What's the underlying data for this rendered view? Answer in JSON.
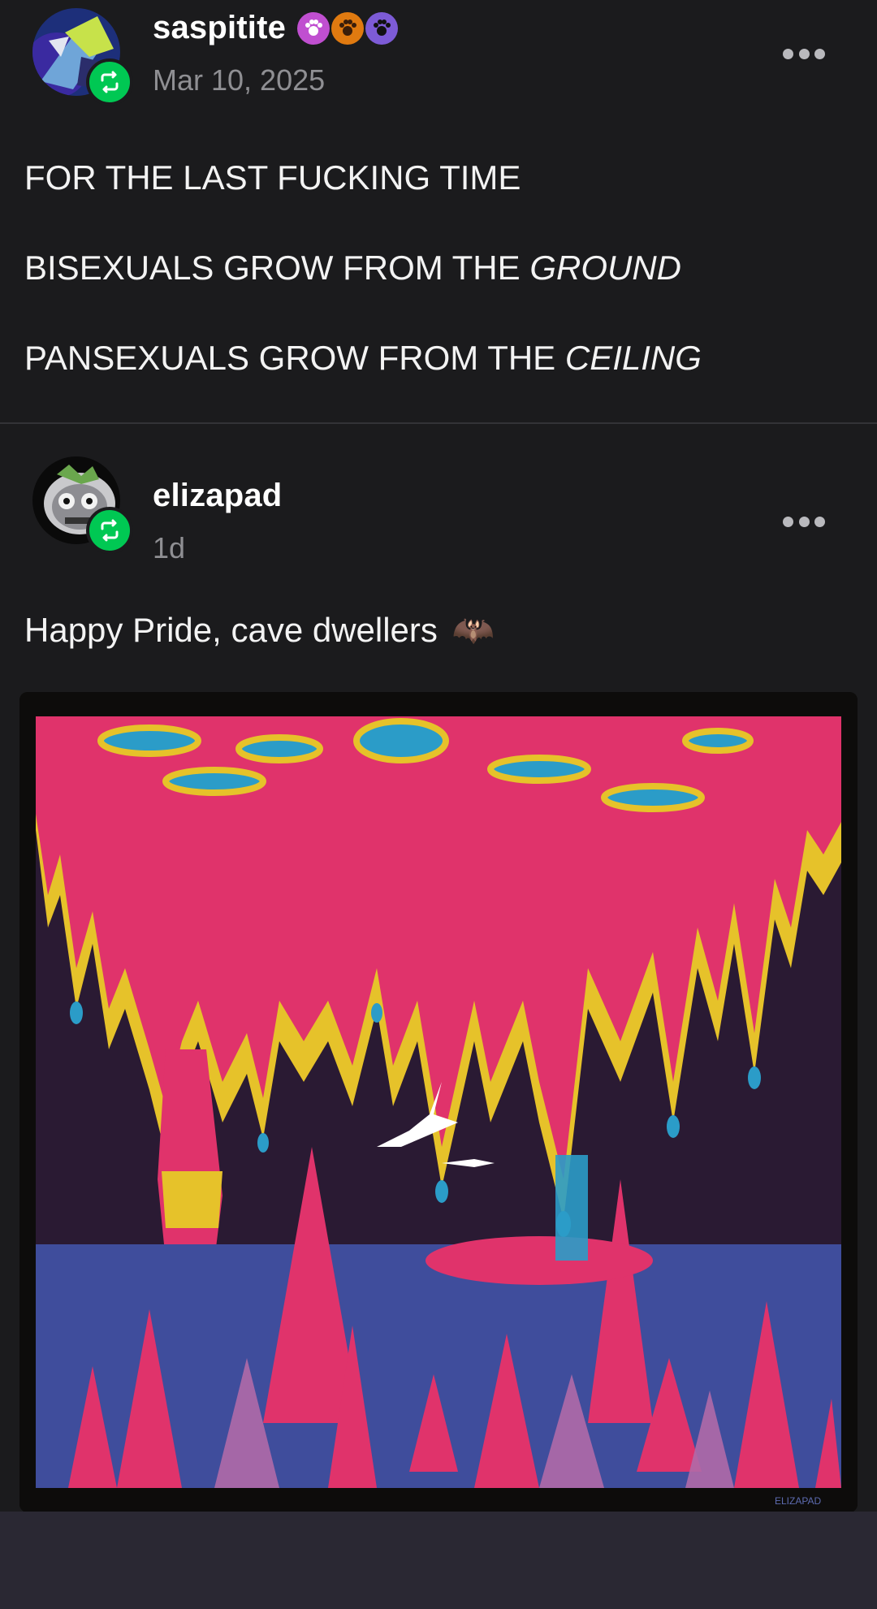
{
  "posts": [
    {
      "username": "saspitite",
      "timestamp": "Mar 10, 2025",
      "avatar": "reblog-avatar",
      "badges": [
        "paw-icon",
        "paw-icon",
        "paw-icon"
      ],
      "lines": {
        "l1": "FOR THE LAST FUCKING TIME",
        "l2_plain": "BISEXUALS GROW FROM THE ",
        "l2_em": "GROUND",
        "l3_plain": "PANSEXUALS GROW FROM THE ",
        "l3_em": "CEILING"
      }
    },
    {
      "username": "elizapad",
      "timestamp": "1d",
      "text": "Happy Pride, cave dwellers",
      "emoji": "🦇",
      "image": {
        "description_icon": "cave-illustration-image",
        "signature": "ELIZAPAD"
      }
    }
  ],
  "colors": {
    "background": "#1b1b1d",
    "reblog_green": "#00c853",
    "pink": "#e0336b",
    "yellow": "#e6c22a",
    "blue": "#2b9cc8",
    "navy": "#3f4d9c",
    "cave_dark": "#2a1a33"
  }
}
